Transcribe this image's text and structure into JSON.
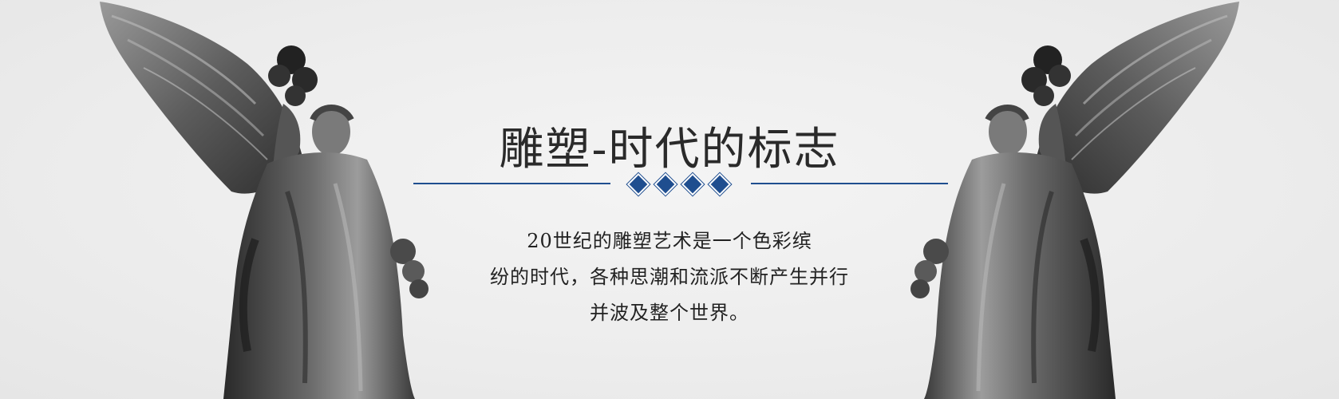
{
  "banner": {
    "title": "雕塑-时代的标志",
    "description_lines": [
      "20世纪的雕塑艺术是一个色彩缤",
      "纷的时代，各种思潮和流派不断产生并行",
      "并波及整个世界。"
    ],
    "accent_color": "#1f4e8f",
    "background_color": "#ececec",
    "decoration": "four-diamond-divider",
    "images": [
      "angel-statue-left",
      "angel-statue-right-mirrored"
    ]
  }
}
